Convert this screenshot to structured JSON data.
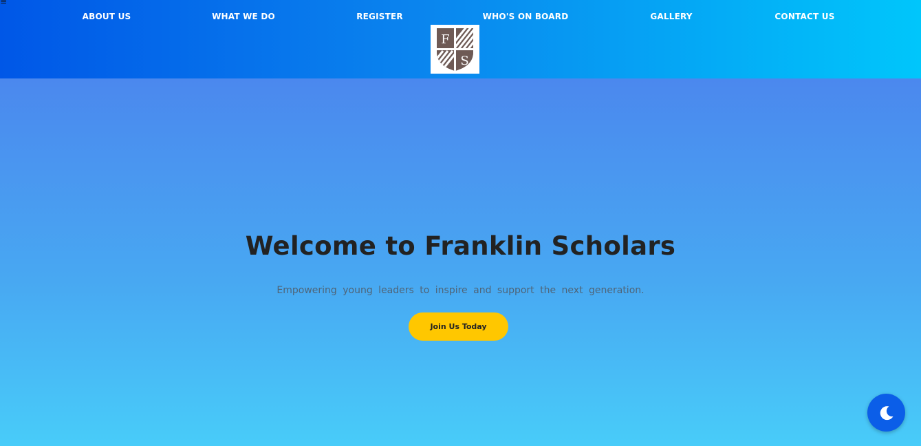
{
  "header": {
    "menu_icon": "≡",
    "nav": [
      {
        "label": "ABOUT US"
      },
      {
        "label": "WHAT WE DO"
      },
      {
        "label": "REGISTER"
      },
      {
        "label": "WHO'S ON BOARD"
      },
      {
        "label": "GALLERY"
      },
      {
        "label": "CONTACT US"
      }
    ],
    "logo": {
      "letters": [
        "F",
        "S"
      ],
      "color": "#6e5a55"
    }
  },
  "hero": {
    "title": "Welcome to Franklin Scholars",
    "subtitle": "Empowering young leaders to inspire and support the next generation.",
    "cta_label": "Join Us Today"
  },
  "colors": {
    "header_start": "#0057e7",
    "header_end": "#00c6fb",
    "hero_top": "#4b88ee",
    "hero_bottom": "#48ccf9",
    "cta": "#ffc700",
    "theme_toggle": "#0b5ee8"
  },
  "icons": {
    "menu": "hamburger-icon",
    "theme_toggle": "moon-icon"
  }
}
